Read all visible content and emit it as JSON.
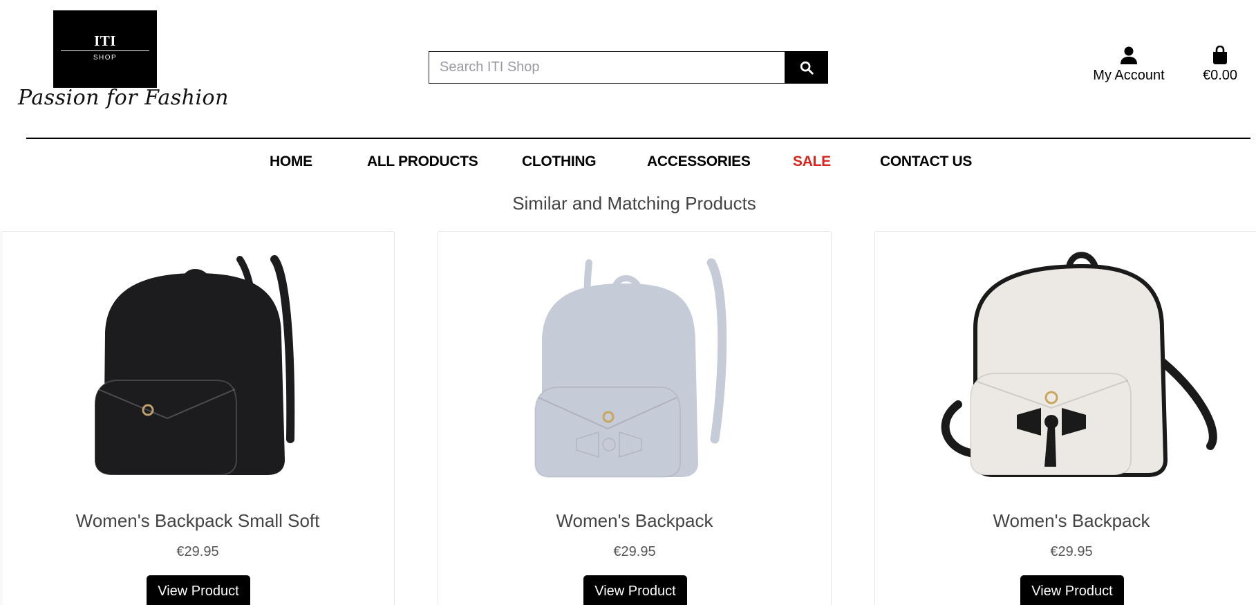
{
  "brand": {
    "logo_text": "ITI",
    "logo_subtext": "SHOP",
    "tagline": "Passion for Fashion"
  },
  "search": {
    "placeholder": "Search ITI Shop",
    "icon": "search-icon"
  },
  "header": {
    "account_label": "My Account",
    "account_icon": "user-icon",
    "cart_total": "€0.00",
    "cart_icon": "shopping-bag-icon"
  },
  "nav": {
    "items": [
      {
        "label": "HOME"
      },
      {
        "label": "ALL PRODUCTS"
      },
      {
        "label": "CLOTHING"
      },
      {
        "label": "ACCESSORIES"
      },
      {
        "label": "SALE",
        "color": "#d9251d"
      },
      {
        "label": "CONTACT US"
      }
    ]
  },
  "section": {
    "title": "Similar and Matching Products"
  },
  "products": [
    {
      "name": "Women's Backpack Small Soft",
      "price": "€29.95",
      "button": "View Product",
      "bag_color": "#1c1c1e"
    },
    {
      "name": "Women's Backpack",
      "price": "€29.95",
      "button": "View Product",
      "bag_color": "#c6cbd8"
    },
    {
      "name": "Women's Backpack",
      "price": "€29.95",
      "button": "View Product",
      "bag_color": "#ece9e4"
    }
  ],
  "colors": {
    "accent": "#000000",
    "sale": "#d9251d"
  }
}
